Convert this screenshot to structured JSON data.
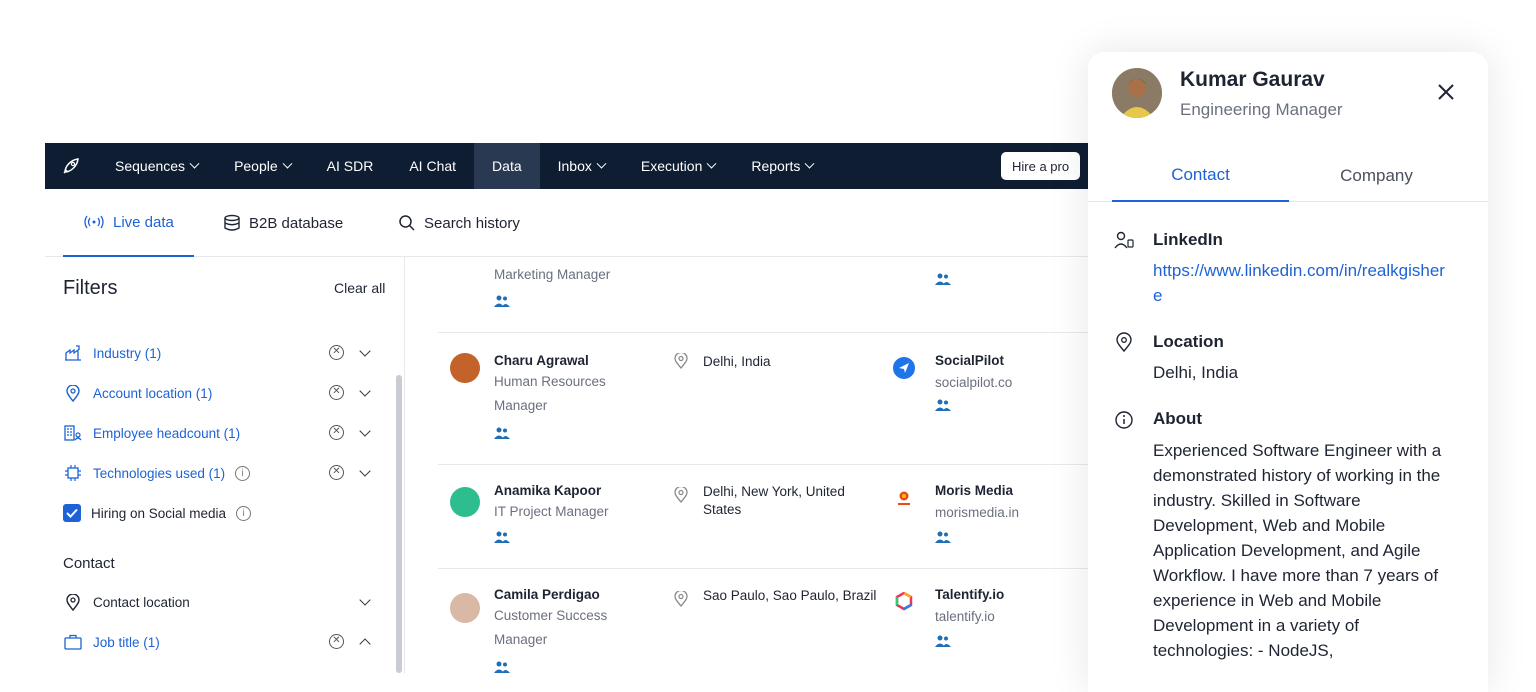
{
  "nav": {
    "items": [
      {
        "label": "Sequences",
        "chevron": true
      },
      {
        "label": "People",
        "chevron": true
      },
      {
        "label": "AI SDR",
        "chevron": false
      },
      {
        "label": "AI Chat",
        "chevron": false
      },
      {
        "label": "Data",
        "chevron": false,
        "active": true
      },
      {
        "label": "Inbox",
        "chevron": true
      },
      {
        "label": "Execution",
        "chevron": true
      },
      {
        "label": "Reports",
        "chevron": true
      }
    ],
    "hire_label": "Hire a pro"
  },
  "subtabs": {
    "live": "Live data",
    "b2b": "B2B database",
    "history": "Search history"
  },
  "filters": {
    "title": "Filters",
    "clear_all": "Clear all",
    "items": [
      {
        "label": "Industry (1)",
        "icon": "industry-icon"
      },
      {
        "label": "Account location (1)",
        "icon": "location-pin-icon"
      },
      {
        "label": "Employee headcount (1)",
        "icon": "building-icon"
      },
      {
        "label": "Technologies used (1)",
        "icon": "chip-icon"
      }
    ],
    "hiring_label": "Hiring on Social media",
    "contact_heading": "Contact",
    "contact_location": "Contact location",
    "job_title": "Job title (1)"
  },
  "results": {
    "top_title": "Marketing Manager",
    "rows": [
      {
        "name": "Charu Agrawal",
        "title": "Human Resources Manager",
        "location": "Delhi, India",
        "company": "SocialPilot",
        "domain": "socialpilot.co"
      },
      {
        "name": "Anamika Kapoor",
        "title": "IT Project Manager",
        "location": "Delhi, New York, United States",
        "company": "Moris Media",
        "domain": "morismedia.in"
      },
      {
        "name": "Camila Perdigao",
        "title": "Customer Success Manager",
        "location": "Sao Paulo, Sao Paulo, Brazil",
        "company": "Talentify.io",
        "domain": "talentify.io"
      }
    ]
  },
  "panel": {
    "name": "Kumar Gaurav",
    "job": "Engineering Manager",
    "tabs": [
      "Contact",
      "Company"
    ],
    "linkedin_heading": "LinkedIn",
    "linkedin_url": "https://www.linkedin.com/in/realkgishere",
    "location_heading": "Location",
    "location": "Delhi, India",
    "about_heading": "About",
    "about": "Experienced Software Engineer with a demonstrated history of working in the industry. Skilled in Software Development, Web and Mobile Application Development, and Agile Workflow. I have more than 7 years of experience in Web and Mobile Development in a variety of technologies: - NodeJS,"
  },
  "colors": {
    "nav_bg": "#0f1d33",
    "accent": "#1e62d6",
    "people_icon": "#1f6fb8"
  }
}
